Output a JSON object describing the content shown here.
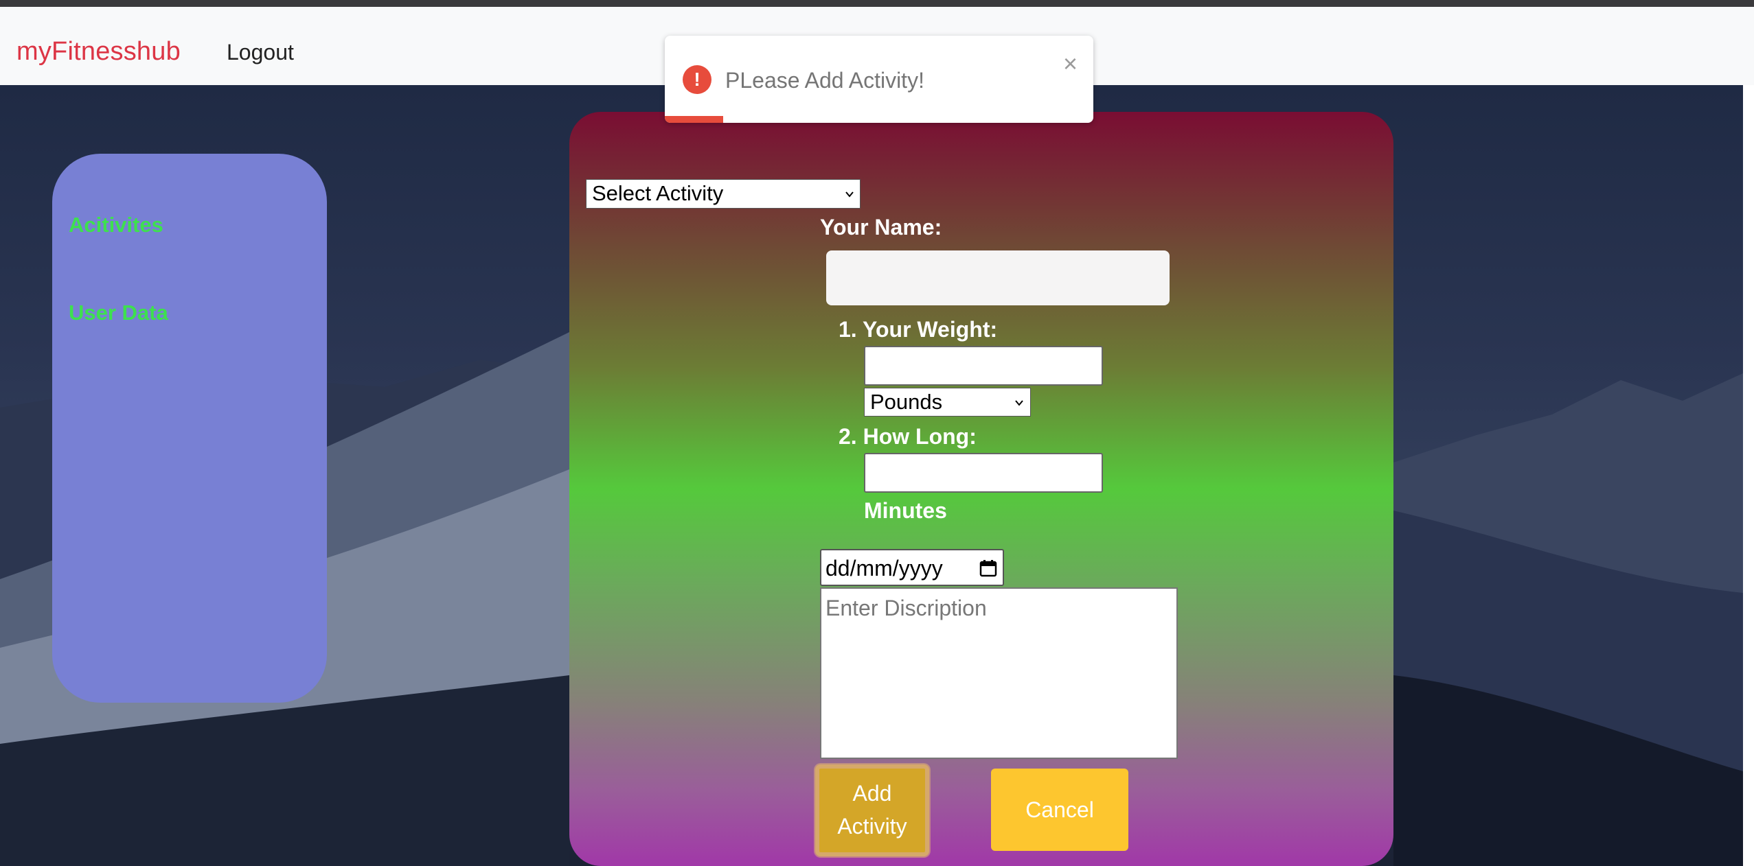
{
  "navbar": {
    "brand": "myFitnesshub",
    "logout_label": "Logout"
  },
  "sidebar": {
    "items": [
      {
        "label": "Acitivites"
      },
      {
        "label": "User Data"
      }
    ]
  },
  "form": {
    "activity_select": {
      "selected": "Select Activity"
    },
    "name_label": "Your Name:",
    "name_value": "",
    "weight_label": "1. Your Weight:",
    "weight_value": "",
    "units_select": {
      "selected": "Pounds"
    },
    "duration_label": "2. How Long:",
    "duration_value": "",
    "minutes_label": "Minutes",
    "date_placeholder": "dd/mm/yyyy",
    "description_placeholder": "Enter Discription",
    "add_button_line1": "Add",
    "add_button_line2": "Activity",
    "cancel_button": "Cancel"
  },
  "toast": {
    "message": "PLease Add Activity!",
    "icon": "exclamation-icon",
    "close_icon": "close-icon",
    "color": "#e74c3c"
  },
  "colors": {
    "brand": "#dc3545",
    "sidebar_bg": "#7880d4",
    "sidebar_link": "#3ee04f",
    "add_button": "#d4a628",
    "cancel_button": "#fdc62f"
  }
}
